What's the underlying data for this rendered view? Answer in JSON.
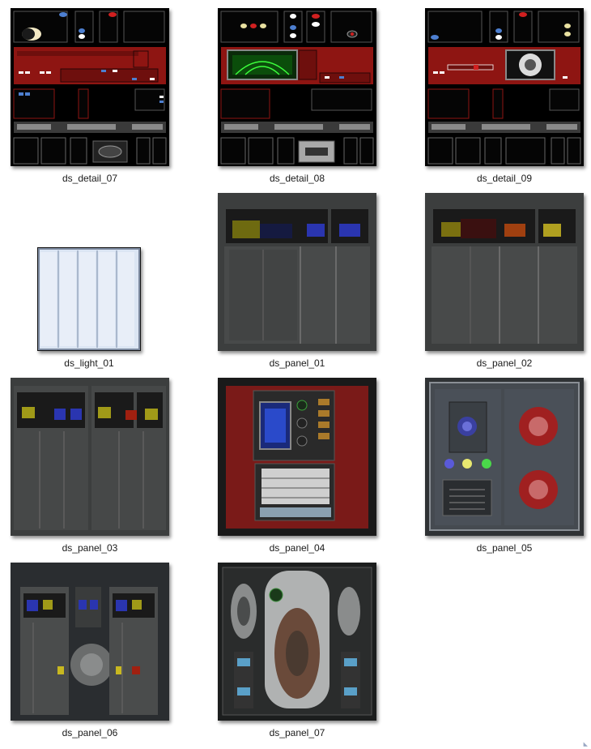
{
  "files": [
    {
      "name": "ds_detail_07"
    },
    {
      "name": "ds_detail_08"
    },
    {
      "name": "ds_detail_09"
    },
    {
      "name": "ds_light_01"
    },
    {
      "name": "ds_panel_01"
    },
    {
      "name": "ds_panel_02"
    },
    {
      "name": "ds_panel_03"
    },
    {
      "name": "ds_panel_04"
    },
    {
      "name": "ds_panel_05"
    },
    {
      "name": "ds_panel_06"
    },
    {
      "name": "ds_panel_07"
    }
  ],
  "colors": {
    "console_red": "#8e1512",
    "panel_gray": "#3c3e3e",
    "light_blue": "#dbe5f3"
  }
}
